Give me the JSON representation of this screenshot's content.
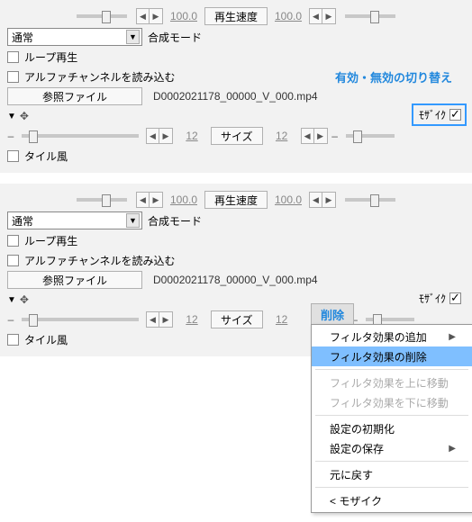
{
  "common": {
    "speed_value": "100.0",
    "speed_label": "再生速度",
    "blend_label": "合成モード",
    "select_value": "通常",
    "loop_label": "ループ再生",
    "alpha_label": "アルファチャンネルを読み込む",
    "ref_label": "参照ファイル",
    "filename": "D0002021178_00000_V_000.mp4",
    "size_value": "12",
    "size_label": "サイズ",
    "tile_label": "タイル風",
    "mosaic_label": "ﾓｻﾞｲｸ"
  },
  "annot": {
    "toggle": "有効・無効の切り替え",
    "delete": "削除"
  },
  "menu": {
    "add": "フィルタ効果の追加",
    "remove": "フィルタ効果の削除",
    "move_up": "フィルタ効果を上に移動",
    "move_down": "フィルタ効果を下に移動",
    "reset": "設定の初期化",
    "save": "設定の保存",
    "undo": "元に戻す",
    "mosaic": "< モザイク"
  }
}
